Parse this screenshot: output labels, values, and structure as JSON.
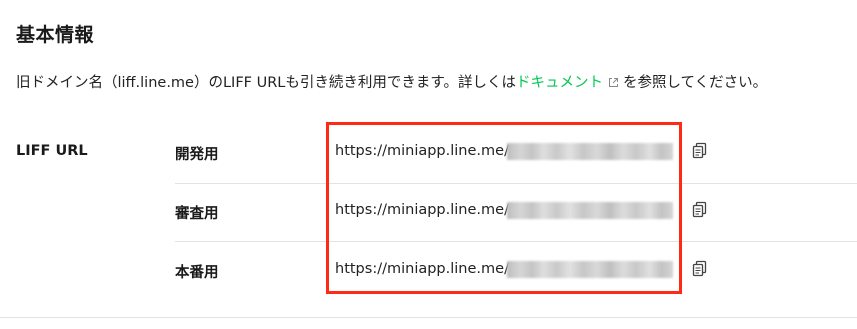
{
  "section": {
    "title": "基本情報"
  },
  "description": {
    "before_link": "旧ドメイン名（liff.line.me）のLIFF URLも引き続き利用できます。詳しくは",
    "link_text": "ドキュメント",
    "after_link": "を参照してください。",
    "link_icon": "external-link-icon"
  },
  "liff_url": {
    "header": "LIFF URL",
    "rows": [
      {
        "label": "開発用",
        "url": "https://miniapp.line.me/",
        "copy_icon": "copy-icon"
      },
      {
        "label": "審査用",
        "url": "https://miniapp.line.me/",
        "copy_icon": "copy-icon"
      },
      {
        "label": "本番用",
        "url": "https://miniapp.line.me/",
        "copy_icon": "copy-icon"
      }
    ]
  },
  "colors": {
    "link": "#06c755",
    "highlight": "#ff2a16",
    "divider": "#e3e3e3",
    "text": "#1a1a1a"
  }
}
